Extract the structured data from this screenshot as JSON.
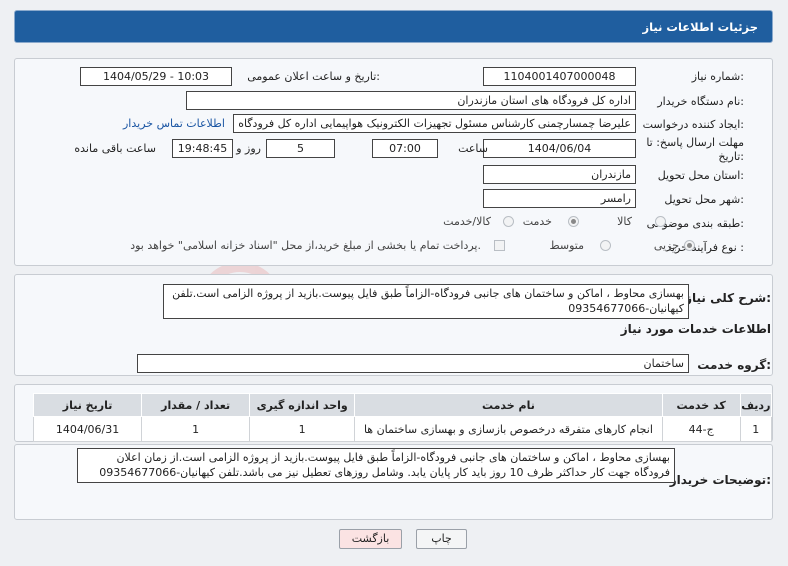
{
  "header": {
    "title": "جزئیات اطلاعات نیاز"
  },
  "form": {
    "need_number_label": "شماره نیاز:",
    "need_number": "1104001407000048",
    "announce_label": "تاریخ و ساعت اعلان عمومی:",
    "announce_value": "1404/05/29 - 10:03",
    "buyer_org_label": "نام دستگاه خریدار:",
    "buyer_org": "اداره کل فرودگاه های استان مازندران",
    "requester_label": "ایجاد کننده درخواست:",
    "requester": "علیرضا چمسارچمنی کارشناس مسئول تجهیزات الکترونیک هواپیمایی اداره کل فرودگاه های استان مازندران",
    "contact_link": "اطلاعات تماس خریدار",
    "deadline_label": "مهلت ارسال پاسخ: تا تاریخ:",
    "deadline_date": "1404/06/04",
    "time_label": "ساعت",
    "deadline_time": "07:00",
    "days_value": "5",
    "days_label": "روز و",
    "remaining_time": "19:48:45",
    "remaining_label": "ساعت باقی مانده",
    "delivery_province_label": "استان محل تحویل:",
    "delivery_province": "مازندران",
    "delivery_city_label": "شهر محل تحویل:",
    "delivery_city": "رامسر",
    "category_label": "طبقه بندی موضوعی:",
    "category_options": [
      "کالا",
      "خدمت",
      "کالا/خدمت"
    ],
    "category_selected": 1,
    "process_label": "نوع فرآیند خرید :",
    "process_options": [
      "جزیی",
      "متوسط"
    ],
    "process_selected": 0,
    "payment_note": "پرداخت تمام یا بخشی از مبلغ خرید،از محل \"اسناد خزانه اسلامی\" خواهد بود."
  },
  "description": {
    "label": "شرح کلی نیاز:",
    "text": "بهسازی محاوط ، اماکن و ساختمان های جانبی فرودگاه-الزاماً طبق فایل پیوست.بازید از پروژه الزامی است.تلفن کیهانیان-09354677066"
  },
  "services": {
    "section_title": "اطلاعات خدمات مورد نیاز",
    "group_label": "گروه خدمت:",
    "group_value": "ساختمان",
    "columns": [
      "ردیف",
      "کد خدمت",
      "نام خدمت",
      "واحد اندازه گیری",
      "تعداد / مقدار",
      "تاریخ نیاز"
    ],
    "rows": [
      [
        "1",
        "ج-44",
        "انجام کارهای متفرقه درخصوص بازسازی و بهسازی ساختمان ها",
        "1",
        "1",
        "1404/06/31"
      ]
    ]
  },
  "buyer_notes": {
    "label": "توضیحات خریدار:",
    "text": "بهسازی محاوط ، اماکن و ساختمان های جانبی فرودگاه-الزاماً طبق فایل پیوست.بازید از پروژه الزامی است.از زمان اعلان فرودگاه جهت کار حداکثر ظرف 10 روز باید کار پایان یابد. وشامل روزهای تعطیل نیز می باشد.تلفن کیهانیان-09354677066"
  },
  "buttons": {
    "print": "چاپ",
    "back": "بازگشت"
  },
  "watermark": {
    "text": "AriaTender.net"
  },
  "colors": {
    "header": "#1f5e9f",
    "link": "#1a55a3",
    "back_button": "#fbe3e3",
    "watermark": "#e9b8b8"
  }
}
